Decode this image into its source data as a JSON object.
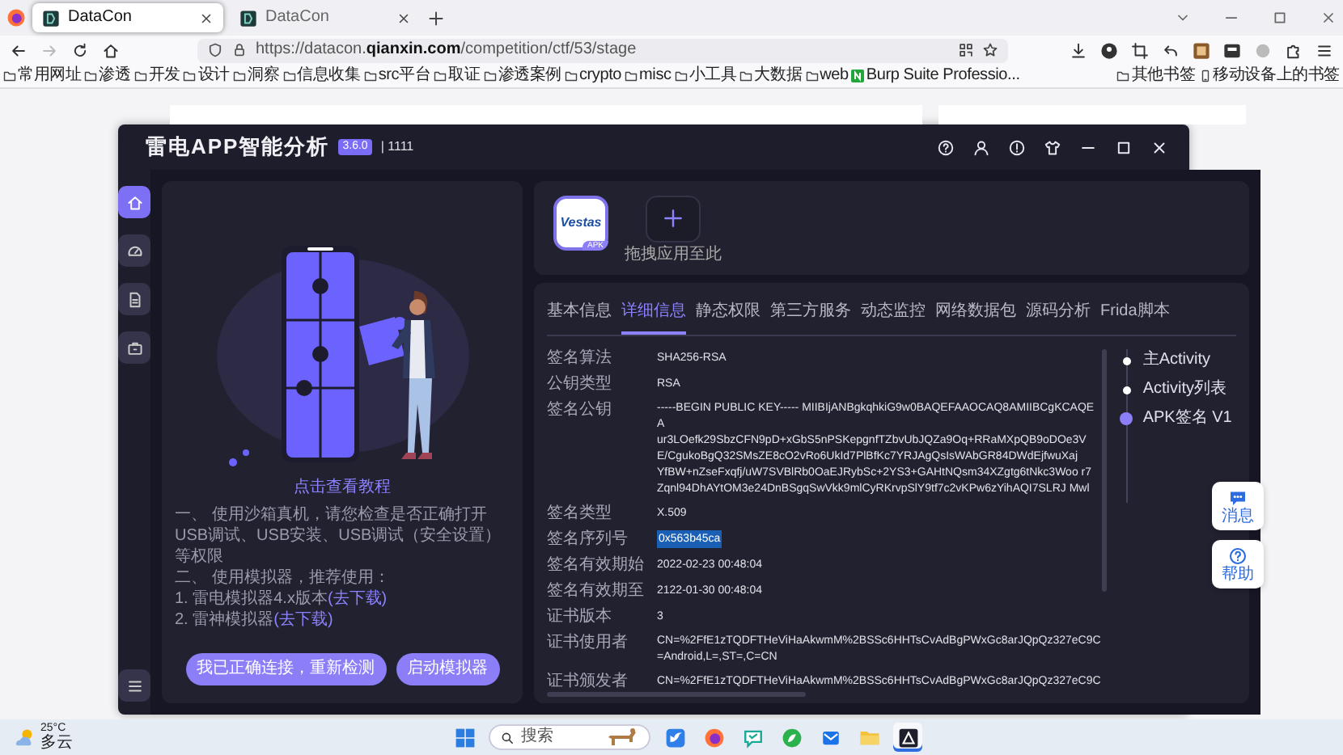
{
  "browser": {
    "tabs": [
      {
        "title": "DataCon",
        "selected": true
      },
      {
        "title": "DataCon",
        "selected": false
      }
    ],
    "nav": [
      {
        "kind": "back",
        "disabled": false
      },
      {
        "kind": "forward",
        "disabled": true
      },
      {
        "kind": "reload",
        "disabled": false
      },
      {
        "kind": "home",
        "disabled": false
      }
    ],
    "url": {
      "prefix": "https://datacon.",
      "host": "qianxin.com",
      "path": "/competition/ctf/53/stage"
    },
    "bookmarks": [
      {
        "kind": "folder",
        "label": "常用网址"
      },
      {
        "kind": "folder",
        "label": "渗透"
      },
      {
        "kind": "folder",
        "label": "开发"
      },
      {
        "kind": "folder",
        "label": "设计"
      },
      {
        "kind": "folder",
        "label": "洞察"
      },
      {
        "kind": "folder",
        "label": "信息收集"
      },
      {
        "kind": "folder",
        "label": "src平台"
      },
      {
        "kind": "folder",
        "label": "取证"
      },
      {
        "kind": "folder",
        "label": "渗透案例"
      },
      {
        "kind": "folder",
        "label": "crypto"
      },
      {
        "kind": "folder",
        "label": "misc"
      },
      {
        "kind": "folder",
        "label": "小工具"
      },
      {
        "kind": "folder",
        "label": "大数据"
      },
      {
        "kind": "folder",
        "label": "web"
      },
      {
        "kind": "site",
        "label": "Burp Suite Professio..."
      }
    ],
    "other_bookmarks": [
      {
        "kind": "folder",
        "label": "其他书签"
      },
      {
        "kind": "device",
        "label": "移动设备上的书签"
      }
    ]
  },
  "app": {
    "title": "雷电APP智能分析",
    "version": "3.6.0",
    "account": "| 1111",
    "sidebar": [
      {
        "kind": "home",
        "selected": true
      },
      {
        "kind": "gauge",
        "selected": false
      },
      {
        "kind": "document",
        "selected": false
      },
      {
        "kind": "case",
        "selected": false
      }
    ],
    "upload": {
      "apps": [
        {
          "logo": "Vestas",
          "badge": "APK",
          "selected": true
        }
      ],
      "drop_hint": "拖拽应用至此"
    },
    "guide": {
      "link": "点击查看教程",
      "steps": [
        {
          "text": "一、 使用沙箱真机，请您检查是否正确打开USB调试、USB安装、USB调试（安全设置）等权限"
        },
        {
          "text": "二、 使用模拟器，推荐使用："
        },
        {
          "text": "1. 雷电模拟器4.x版本",
          "link": "(去下载)"
        },
        {
          "text": "2. 雷神模拟器",
          "link": "(去下载)"
        }
      ],
      "buttons": [
        "我已正确连接，重新检测",
        "启动模拟器"
      ]
    },
    "detail": {
      "tabs": [
        {
          "label": "基本信息",
          "selected": false
        },
        {
          "label": "详细信息",
          "selected": true
        },
        {
          "label": "静态权限",
          "selected": false
        },
        {
          "label": "第三方服务",
          "selected": false
        },
        {
          "label": "动态监控",
          "selected": false
        },
        {
          "label": "网络数据包",
          "selected": false
        },
        {
          "label": "源码分析",
          "selected": false
        },
        {
          "label": "Frida脚本",
          "selected": false
        }
      ],
      "rows": [
        {
          "label": "签名算法",
          "lines": [
            "SHA256-RSA"
          ],
          "highlighted": false
        },
        {
          "label": "公钥类型",
          "lines": [
            "RSA"
          ],
          "highlighted": false
        },
        {
          "label": "签名公钥",
          "lines": [
            "-----BEGIN PUBLIC KEY----- MIIBIjANBgkqhkiG9w0BAQEFAAOCAQ8AMIIBCgKCAQEA",
            "ur3LOefk29SbzCFN9pD+xGbS5nPSKepgnfTZbvUbJQZa9Oq+RRaMXpQB9oDOe3V",
            "E/CgukoBgQ32SMsZE8cO2vRo6UkId7PlBfKc7YRJAgQsIsWAbGR84DWdEjfwuXaj",
            "YfBW+nZseFxqfj/uW7SVBlRb0OaEJRybSc+2YS3+GAHtNQsm34XZgtg6tNkc3Woo r7",
            "Zqnl94DhAYtOM3e24DnBSgqSwVkk9mlCyRKrvpSlY9tf7c2vKPw6zYihAQI7SLRJ Mwl"
          ],
          "highlighted": false
        },
        {
          "label": "签名类型",
          "lines": [
            "X.509"
          ],
          "highlighted": false
        },
        {
          "label": "签名序列号",
          "lines": [
            "0x563b45ca"
          ],
          "highlighted": true
        },
        {
          "label": "签名有效期始",
          "lines": [
            "2022-02-23 00:48:04"
          ],
          "highlighted": false
        },
        {
          "label": "签名有效期至",
          "lines": [
            "2122-01-30 00:48:04"
          ],
          "highlighted": false
        },
        {
          "label": "证书版本",
          "lines": [
            "3"
          ],
          "highlighted": false
        },
        {
          "label": "证书使用者",
          "lines": [
            "CN=%2FfE1zTQDFTHeViHaAkwmM%2BSSc6HHTsCvAdBgPWxGc8arJQpQz327eC9C",
            "=Android,L=,ST=,C=CN"
          ],
          "highlighted": false
        },
        {
          "label": "证书颁发者",
          "lines": [
            "CN=%2FfE1zTQDFTHeViHaAkwmM%2BSSc6HHTsCvAdBgPWxGc8arJQpQz327eC9C"
          ],
          "highlighted": false
        }
      ],
      "timeline": [
        {
          "label": "主Activity",
          "selected": false
        },
        {
          "label": "Activity列表",
          "selected": false
        },
        {
          "label": "APK签名 V1",
          "selected": true
        }
      ]
    }
  },
  "floating_buttons": [
    {
      "kind": "chat",
      "label": "消息"
    },
    {
      "kind": "help",
      "label": "帮助"
    }
  ],
  "taskbar": {
    "weather": {
      "temperature": "25°C",
      "condition": "多云"
    },
    "search_placeholder": "搜索",
    "apps": [
      {
        "kind": "bird",
        "active": false
      },
      {
        "kind": "globe",
        "active": false
      },
      {
        "kind": "bubble",
        "active": false
      },
      {
        "kind": "leaf",
        "active": false
      },
      {
        "kind": "mail",
        "active": false
      },
      {
        "kind": "folder",
        "active": false
      },
      {
        "kind": "triangle",
        "active": true
      }
    ]
  }
}
